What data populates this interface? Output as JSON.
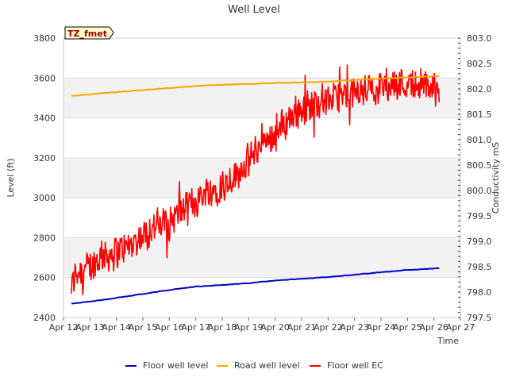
{
  "chart_data": {
    "type": "line",
    "title": "Well Level",
    "badge": "TZ_fmet",
    "xlabel": "Time",
    "ylabel": "Level (ft)",
    "y2label": "Conductivity mS",
    "x_ticks": [
      "Apr 12",
      "Apr 13",
      "Apr 14",
      "Apr 15",
      "Apr 16",
      "Apr 17",
      "Apr 18",
      "Apr 19",
      "Apr 20",
      "Apr 21",
      "Apr 22",
      "Apr 23",
      "Apr 24",
      "Apr 25",
      "Apr 26",
      "Apr 27"
    ],
    "x_range_days": [
      12,
      27
    ],
    "ylim": [
      2400,
      3800
    ],
    "y_ticks": [
      "2400",
      "2600",
      "2800",
      "3000",
      "3200",
      "3400",
      "3600",
      "3800"
    ],
    "y2lim": [
      797.5,
      803.0
    ],
    "y2_ticks": [
      "797.5",
      "798.0",
      "798.5",
      "799.0",
      "799.5",
      "800.0",
      "800.5",
      "801.0",
      "801.5",
      "802.0",
      "802.5",
      "803.0"
    ],
    "grid": "horizontal bands",
    "legend_position": "bottom",
    "series": [
      {
        "name": "Floor well level",
        "color": "#0000cc",
        "axis": "left",
        "x_days": [
          12.3,
          13,
          14,
          15,
          16,
          17,
          18,
          19,
          20,
          21,
          22,
          23,
          24,
          25,
          26.2
        ],
        "values": [
          2470,
          2480,
          2498,
          2518,
          2538,
          2555,
          2563,
          2572,
          2585,
          2594,
          2603,
          2615,
          2627,
          2638,
          2647
        ]
      },
      {
        "name": "Road well level",
        "color": "#ffa500",
        "axis": "left",
        "x_days": [
          12.3,
          13,
          14,
          15,
          16,
          17,
          18,
          19,
          20,
          21,
          22,
          23,
          24,
          25,
          26.2
        ],
        "values": [
          3510,
          3518,
          3530,
          3540,
          3550,
          3560,
          3566,
          3570,
          3575,
          3578,
          3582,
          3590,
          3597,
          3603,
          3610
        ]
      },
      {
        "name": "Floor well EC",
        "color": "#ff0000",
        "axis": "right",
        "x_days": [
          12.3,
          12.5,
          13,
          13.5,
          14,
          14.5,
          15,
          15.5,
          16,
          16.5,
          17,
          17.5,
          18,
          18.5,
          19,
          19.5,
          20,
          20.5,
          21,
          21.5,
          22,
          22.5,
          23,
          23.5,
          24,
          24.5,
          25,
          25.5,
          26,
          26.2
        ],
        "values": [
          798.1,
          798.4,
          798.5,
          798.7,
          798.8,
          798.9,
          799.1,
          799.3,
          799.4,
          799.6,
          799.8,
          800.0,
          800.1,
          800.3,
          800.6,
          800.9,
          801.1,
          801.4,
          801.6,
          801.7,
          801.8,
          801.85,
          801.9,
          802.0,
          802.05,
          802.1,
          802.1,
          802.1,
          802.0,
          801.9
        ]
      }
    ]
  }
}
